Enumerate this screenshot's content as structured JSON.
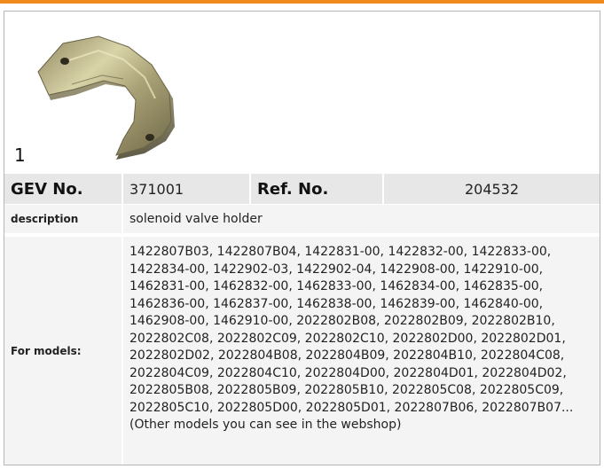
{
  "colors": {
    "accent_bar": "#f08a1d",
    "header_row_bg": "#e7e7e7",
    "body_row_bg": "#f4f4f4"
  },
  "product": {
    "index": "1",
    "image_icon": "solenoid-valve-holder-photo"
  },
  "gev": {
    "label": "GEV No.",
    "value": "371001"
  },
  "ref": {
    "label": "Ref. No.",
    "value": "204532"
  },
  "description": {
    "label": "description",
    "value": "solenoid valve holder"
  },
  "models": {
    "label": "For models:",
    "value": "1422807B03, 1422807B04, 1422831-00, 1422832-00, 1422833-00, 1422834-00, 1422902-03, 1422902-04, 1422908-00, 1422910-00, 1462831-00, 1462832-00, 1462833-00, 1462834-00, 1462835-00, 1462836-00, 1462837-00, 1462838-00, 1462839-00, 1462840-00, 1462908-00, 1462910-00, 2022802B08, 2022802B09, 2022802B10, 2022802C08, 2022802C09, 2022802C10, 2022802D00, 2022802D01, 2022802D02, 2022804B08, 2022804B09, 2022804B10, 2022804C08, 2022804C09, 2022804C10, 2022804D00, 2022804D01, 2022804D02, 2022805B08, 2022805B09, 2022805B10, 2022805C08, 2022805C09, 2022805C10, 2022805D00, 2022805D01, 2022807B06, 2022807B07...",
    "note": "(Other models you can see in the webshop)"
  }
}
